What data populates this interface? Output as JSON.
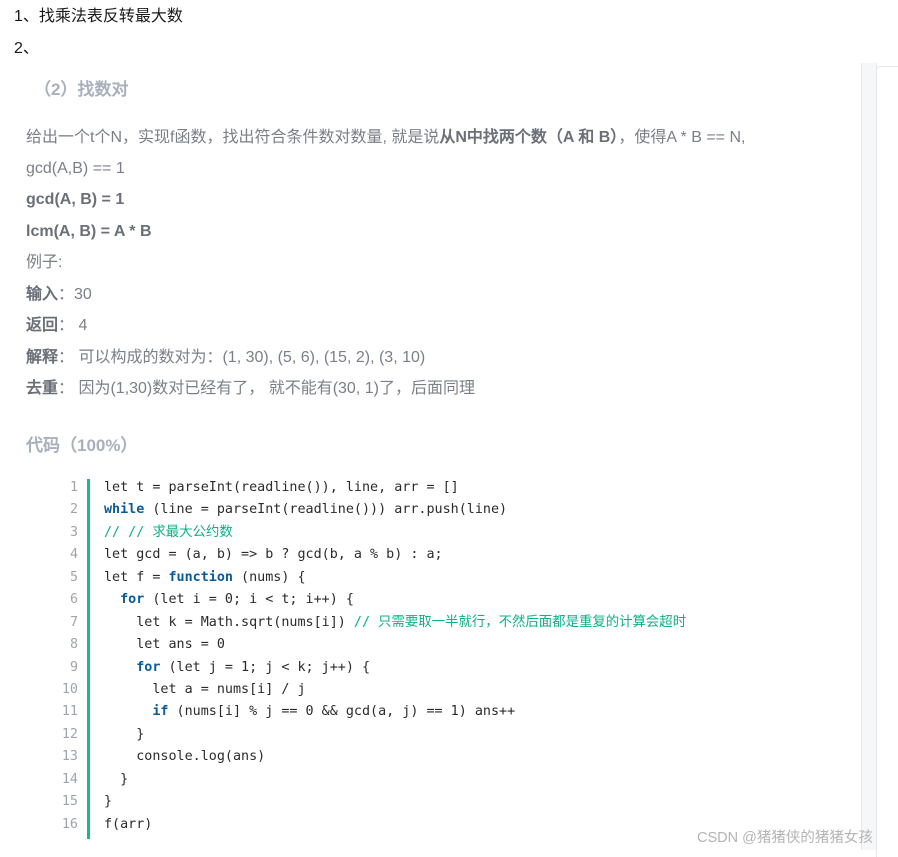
{
  "outline": {
    "item1": "1、找乘法表反转最大数",
    "item2": "2、"
  },
  "section": {
    "title": "（2）找数对",
    "description": {
      "prefix": "给出一个t个N，实现f函数，找出符合条件数对数量, 就是说",
      "bold": "从N中找两个数（A 和 B）",
      "suffix": "，使得A * B == N,"
    },
    "gcd_condition": "gcd(A,B) == 1",
    "gcd_bold": "gcd(A, B) = 1",
    "lcm_bold": "lcm(A, B) = A * B",
    "example_label": "例子:",
    "input_label": "输入",
    "input_value": "：30",
    "return_label": "返回",
    "return_value": "： 4",
    "explain_label": "解释",
    "explain_value": "： 可以构成的数对为：(1, 30), (5, 6), (15, 2), (3, 10)",
    "dedupe_label": "去重",
    "dedupe_value": "： 因为(1,30)数对已经有了， 就不能有(30, 1)了，后面同理",
    "code_heading": "代码（100%）"
  },
  "code": {
    "lines": [
      {
        "n": "1",
        "parts": [
          [
            "",
            "let t = parseInt(readline()), line, arr = []"
          ]
        ]
      },
      {
        "n": "2",
        "parts": [
          [
            "kw",
            "while"
          ],
          [
            "",
            " (line = parseInt(readline())) arr.push(line)"
          ]
        ]
      },
      {
        "n": "3",
        "parts": [
          [
            "cm",
            "// // 求最大公约数"
          ]
        ]
      },
      {
        "n": "4",
        "parts": [
          [
            "",
            "let gcd = (a, b) => b ? gcd(b, a % b) : a;"
          ]
        ]
      },
      {
        "n": "5",
        "parts": [
          [
            "",
            "let f = "
          ],
          [
            "kw",
            "function"
          ],
          [
            "",
            " (nums) {"
          ]
        ]
      },
      {
        "n": "6",
        "parts": [
          [
            "",
            "  "
          ],
          [
            "kw",
            "for"
          ],
          [
            "",
            " (let i = 0; i < t; i++) {"
          ]
        ]
      },
      {
        "n": "7",
        "parts": [
          [
            "",
            "    let k = Math.sqrt(nums[i]) "
          ],
          [
            "cm",
            "// 只需要取一半就行，不然后面都是重复的计算会超时"
          ]
        ]
      },
      {
        "n": "8",
        "parts": [
          [
            "",
            "    let ans = 0"
          ]
        ]
      },
      {
        "n": "9",
        "parts": [
          [
            "",
            "    "
          ],
          [
            "kw",
            "for"
          ],
          [
            "",
            " (let j = 1; j < k; j++) {"
          ]
        ]
      },
      {
        "n": "10",
        "parts": [
          [
            "",
            "      let a = nums[i] / j"
          ]
        ]
      },
      {
        "n": "11",
        "parts": [
          [
            "",
            "      "
          ],
          [
            "kw",
            "if"
          ],
          [
            "",
            " (nums[i] % j == 0 && gcd(a, j) == 1) ans++"
          ]
        ]
      },
      {
        "n": "12",
        "parts": [
          [
            "",
            "    }"
          ]
        ]
      },
      {
        "n": "13",
        "parts": [
          [
            "",
            "    console.log(ans)"
          ]
        ]
      },
      {
        "n": "14",
        "parts": [
          [
            "",
            "  }"
          ]
        ]
      },
      {
        "n": "15",
        "parts": [
          [
            "",
            "}"
          ]
        ]
      },
      {
        "n": "16",
        "parts": [
          [
            "",
            "f(arr)"
          ]
        ]
      }
    ]
  },
  "watermark": "CSDN @猪猪侠的猪猪女孩",
  "colors": {
    "heading": "#a9b0bd",
    "body_text": "#7a7f88",
    "code_border": "#15b991",
    "keyword": "#0b5a9a",
    "comment": "#0cb08a"
  }
}
